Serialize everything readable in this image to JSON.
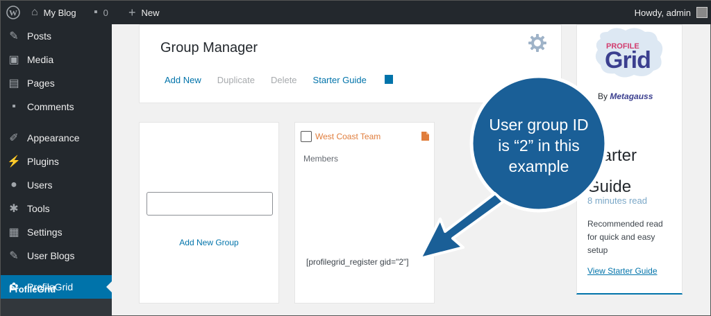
{
  "adminbar": {
    "site_name": "My Blog",
    "comments_count": "0",
    "new_label": "New",
    "howdy": "Howdy, admin"
  },
  "sidebar": {
    "items": [
      {
        "label": "Posts",
        "icon": "pin-icon"
      },
      {
        "label": "Media",
        "icon": "media-icon"
      },
      {
        "label": "Pages",
        "icon": "pages-icon"
      },
      {
        "label": "Comments",
        "icon": "comment-icon"
      },
      {
        "label": "Appearance",
        "icon": "brush-icon"
      },
      {
        "label": "Plugins",
        "icon": "plug-icon"
      },
      {
        "label": "Users",
        "icon": "user-icon"
      },
      {
        "label": "Tools",
        "icon": "wrench-icon"
      },
      {
        "label": "Settings",
        "icon": "settings-icon"
      },
      {
        "label": "User Blogs",
        "icon": "pin-icon"
      },
      {
        "label": "ProfileGrid",
        "icon": "group-icon",
        "active": true
      }
    ],
    "submenu_label": "ProfileGrid",
    "active_color": "#0073aa"
  },
  "group_manager": {
    "title": "Group Manager",
    "add_new": "Add New",
    "duplicate": "Duplicate",
    "delete": "Delete",
    "starter_guide": "Starter Guide"
  },
  "add_group": {
    "input_value": "",
    "link": "Add New Group"
  },
  "group_card": {
    "name": "West Coast Team",
    "members_label": "Members",
    "shortcode": "[profilegrid_register gid=\"2\"]"
  },
  "starter": {
    "logo_top": "PROFILE",
    "logo_main": "Grid",
    "by": "By",
    "brand": "Metagauss",
    "title_line1": "Starter",
    "title_line2": "Guide",
    "read_time": "8 minutes read",
    "description": "Recommended read for quick and easy setup",
    "link": "View Starter Guide"
  },
  "callout": {
    "text": "User group ID is “2” in this example",
    "color": "#0b5b94"
  }
}
